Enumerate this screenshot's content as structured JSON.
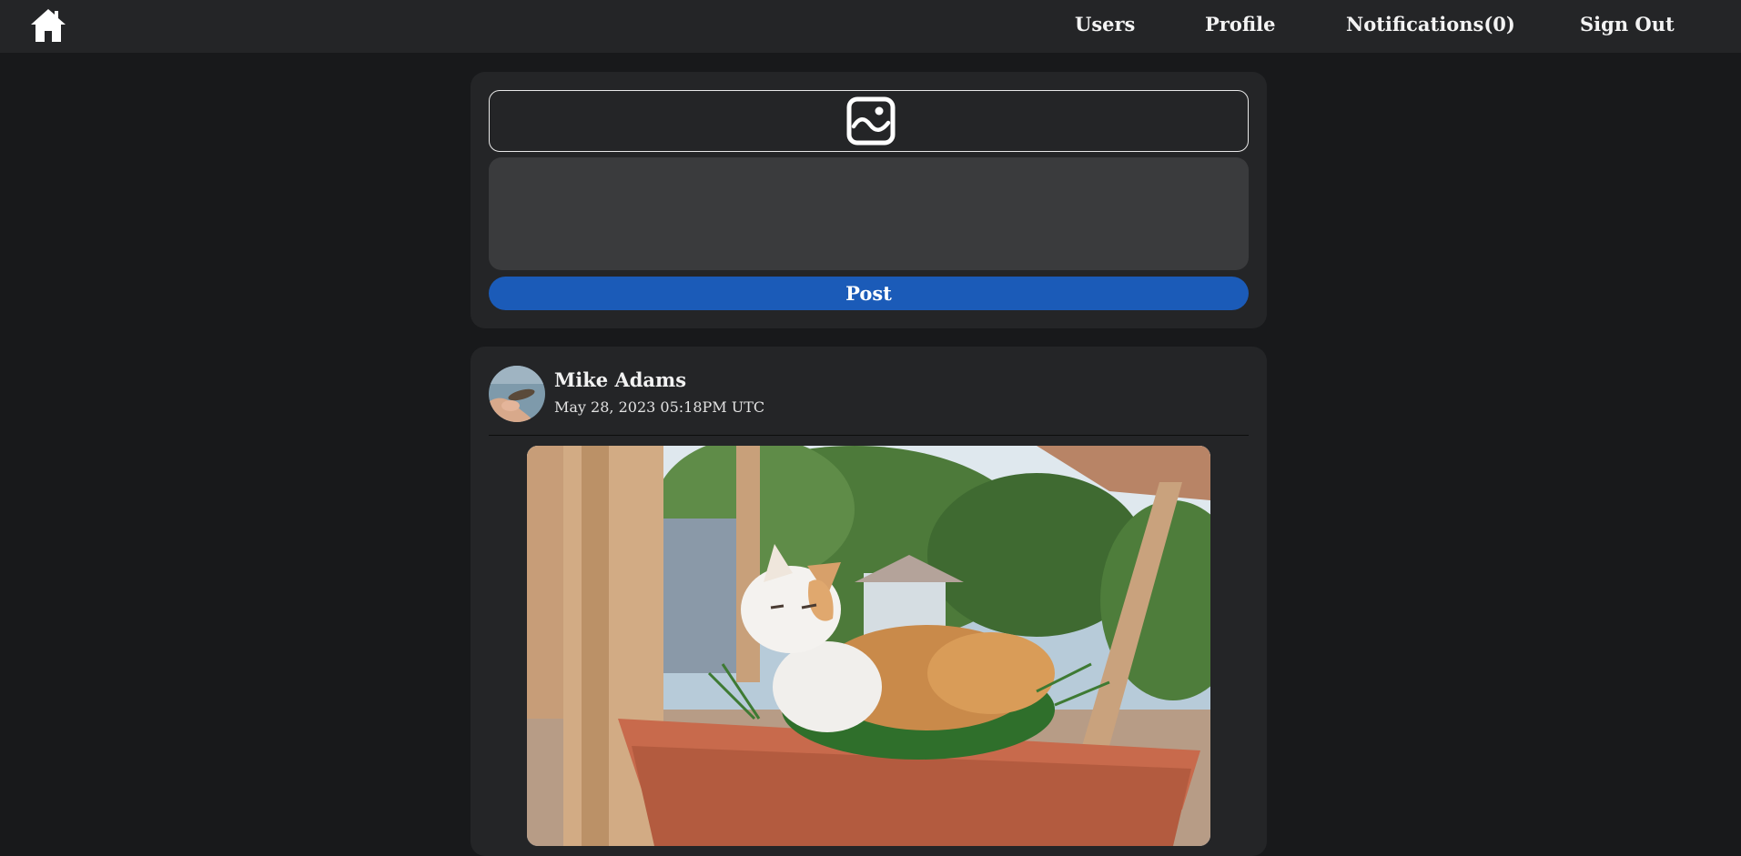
{
  "nav": {
    "home_icon": "home-icon",
    "links": [
      "Users",
      "Profile",
      "Notifications(0)",
      "Sign Out"
    ]
  },
  "composer": {
    "image_icon": "image-icon",
    "text_placeholder": "",
    "post_label": "Post"
  },
  "post": {
    "author": "Mike Adams",
    "timestamp": "May 28, 2023 05:18PM UTC",
    "image_subject": "cat-photo"
  },
  "colors": {
    "page_bg": "#18191b",
    "card_bg": "#242527",
    "input_bg": "#3a3b3d",
    "accent": "#1b5bb8"
  }
}
